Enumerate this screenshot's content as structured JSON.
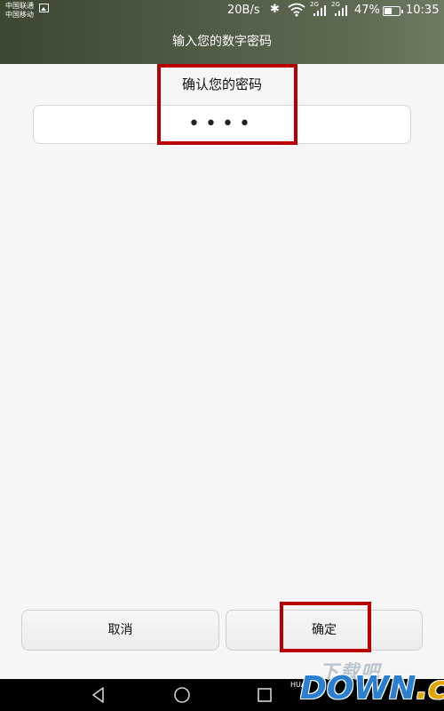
{
  "status_bar": {
    "carrier_1": "中国联通",
    "carrier_2": "中国移动",
    "speed": "20B/s",
    "net_tag_1": "2G",
    "net_tag_2": "2G",
    "battery": "47%",
    "time": "10:35",
    "battery_level": 0.47,
    "icons": [
      "gallery-icon",
      "bluetooth-icon",
      "wifi-icon",
      "signal-icon",
      "signal-icon",
      "battery-icon"
    ]
  },
  "header": {
    "title": "输入您的数字密码"
  },
  "main": {
    "confirm_label": "确认您的密码",
    "password_mask": "••••"
  },
  "buttons": {
    "cancel": "取消",
    "ok": "确定"
  },
  "nav": {
    "icons": [
      "back-icon",
      "home-icon",
      "recent-apps-icon"
    ]
  },
  "watermark": {
    "cn": "下载吧",
    "brand": "HUA",
    "down": "DOWN",
    "cc": ".cc"
  },
  "colors": {
    "header": "#4f5b44",
    "highlight": "#b80000",
    "background": "#f6f6f6"
  }
}
